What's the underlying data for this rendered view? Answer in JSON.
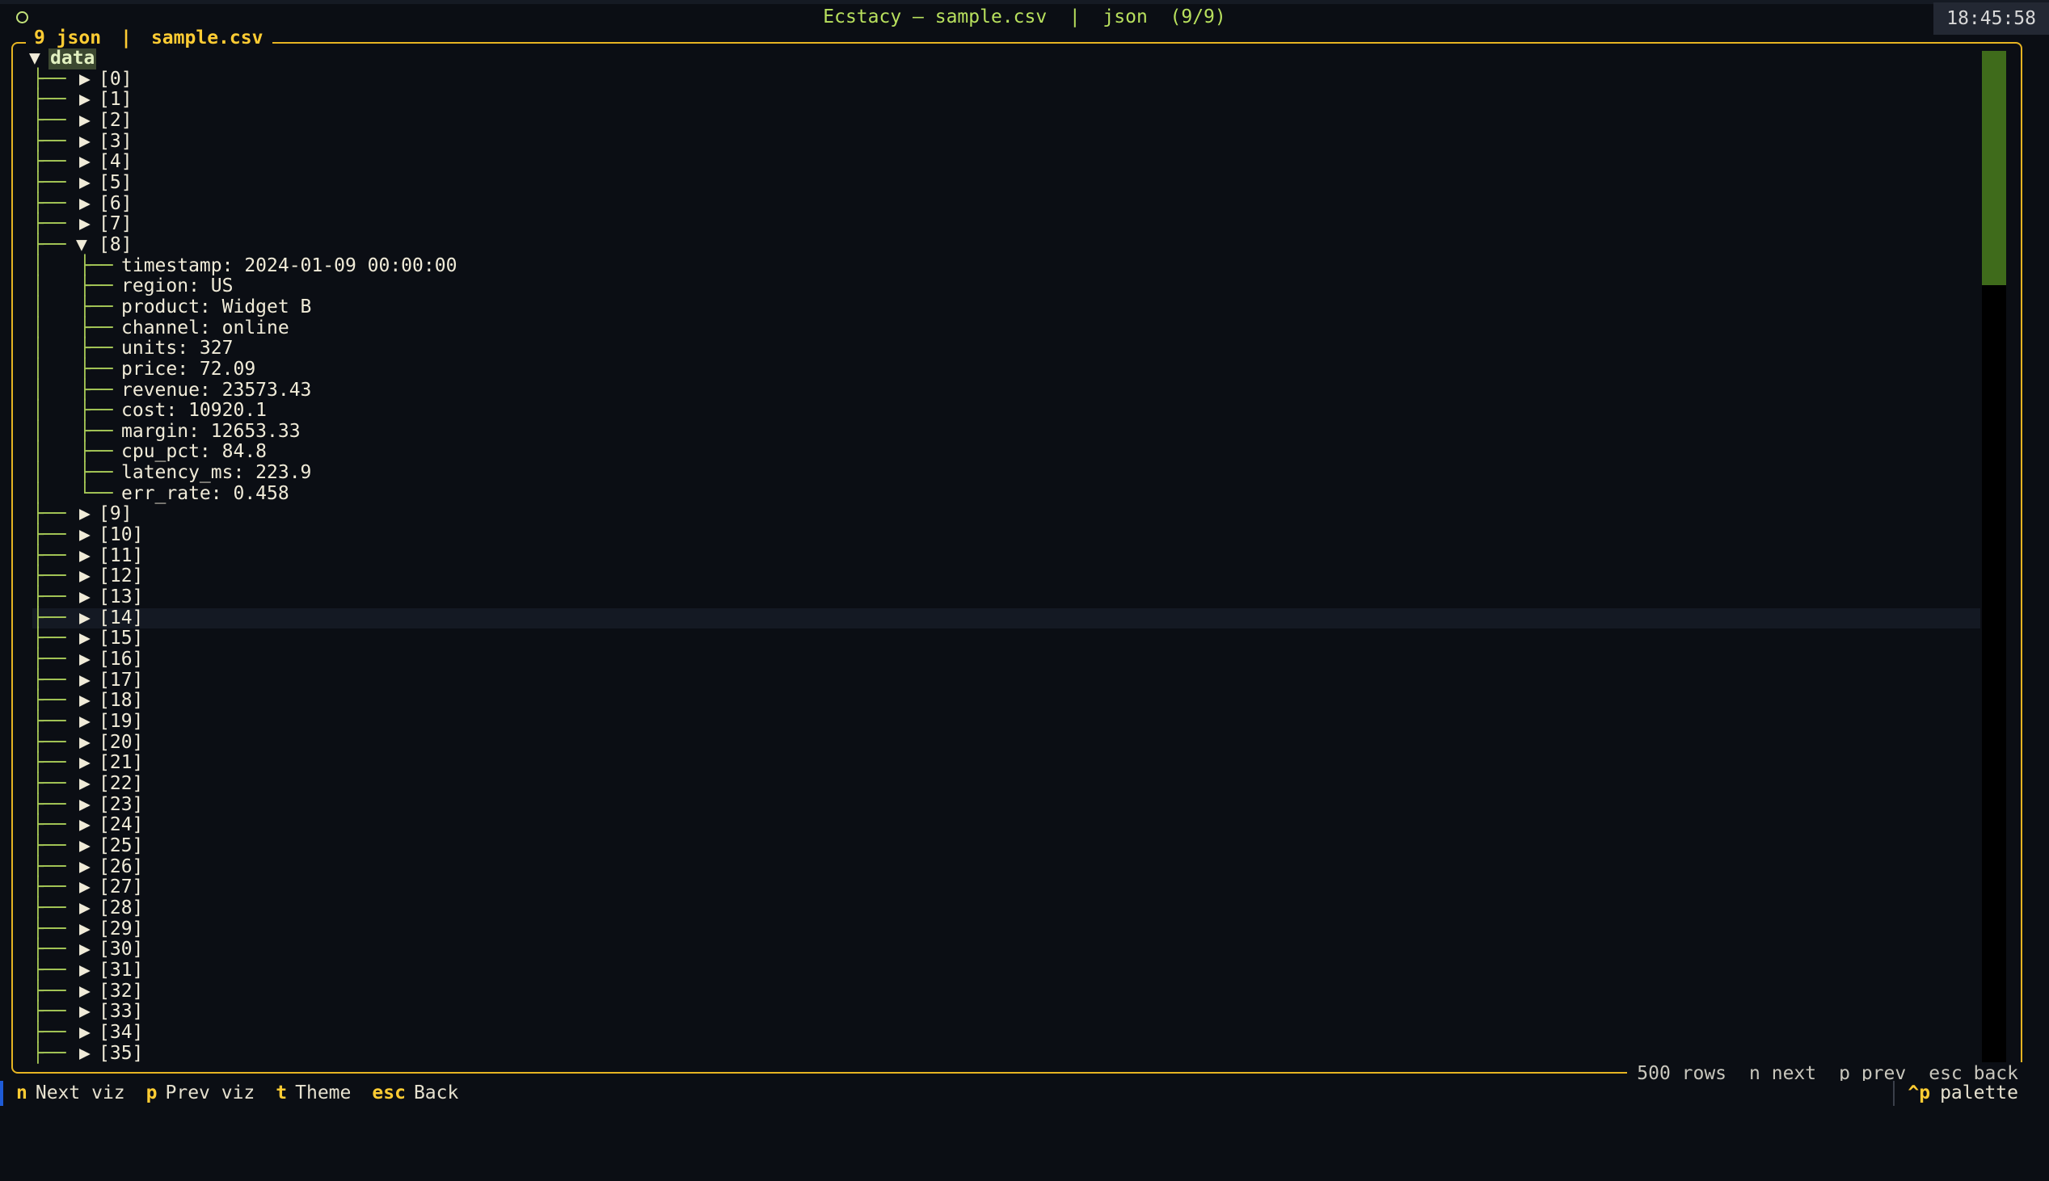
{
  "window": {
    "title": "Ecstacy — sample.csv  |  json  (9/9)",
    "clock": "18:45:58",
    "status_icon": "circle-icon"
  },
  "panel": {
    "tab_label": "9 json",
    "separator": "|",
    "file_label": "sample.csv"
  },
  "tree": {
    "root": "data",
    "items_before": [
      "[0]",
      "[1]",
      "[2]",
      "[3]",
      "[4]",
      "[5]",
      "[6]",
      "[7]"
    ],
    "expanded": {
      "label": "[8]",
      "fields": [
        "timestamp: 2024-01-09 00:00:00",
        "region: US",
        "product: Widget B",
        "channel: online",
        "units: 327",
        "price: 72.09",
        "revenue: 23573.43",
        "cost: 10920.1",
        "margin: 12653.33",
        "cpu_pct: 84.8",
        "latency_ms: 223.9",
        "err_rate: 0.458"
      ]
    },
    "items_after": [
      "[9]",
      "[10]",
      "[11]",
      "[12]",
      "[13]",
      "[14]",
      "[15]",
      "[16]",
      "[17]",
      "[18]",
      "[19]",
      "[20]",
      "[21]",
      "[22]",
      "[23]",
      "[24]",
      "[25]",
      "[26]",
      "[27]",
      "[28]",
      "[29]",
      "[30]",
      "[31]",
      "[32]",
      "[33]",
      "[34]",
      "[35]"
    ],
    "highlighted_item": "[14]"
  },
  "footer": {
    "rows": "500 rows",
    "next": "n next",
    "prev": "p prev",
    "back": "esc back"
  },
  "keybar": {
    "items": [
      {
        "key": "n",
        "label": "Next viz"
      },
      {
        "key": "p",
        "label": "Prev viz"
      },
      {
        "key": "t",
        "label": "Theme"
      },
      {
        "key": "esc",
        "label": "Back"
      }
    ],
    "palette_key": "^p",
    "palette_label": "palette"
  },
  "colors": {
    "background": "#0b0e14",
    "accent_yellow": "#ffcc33",
    "tree_guides": "#a7c957",
    "title_green": "#b8e05d",
    "scroll_thumb": "#3f6b1b"
  }
}
